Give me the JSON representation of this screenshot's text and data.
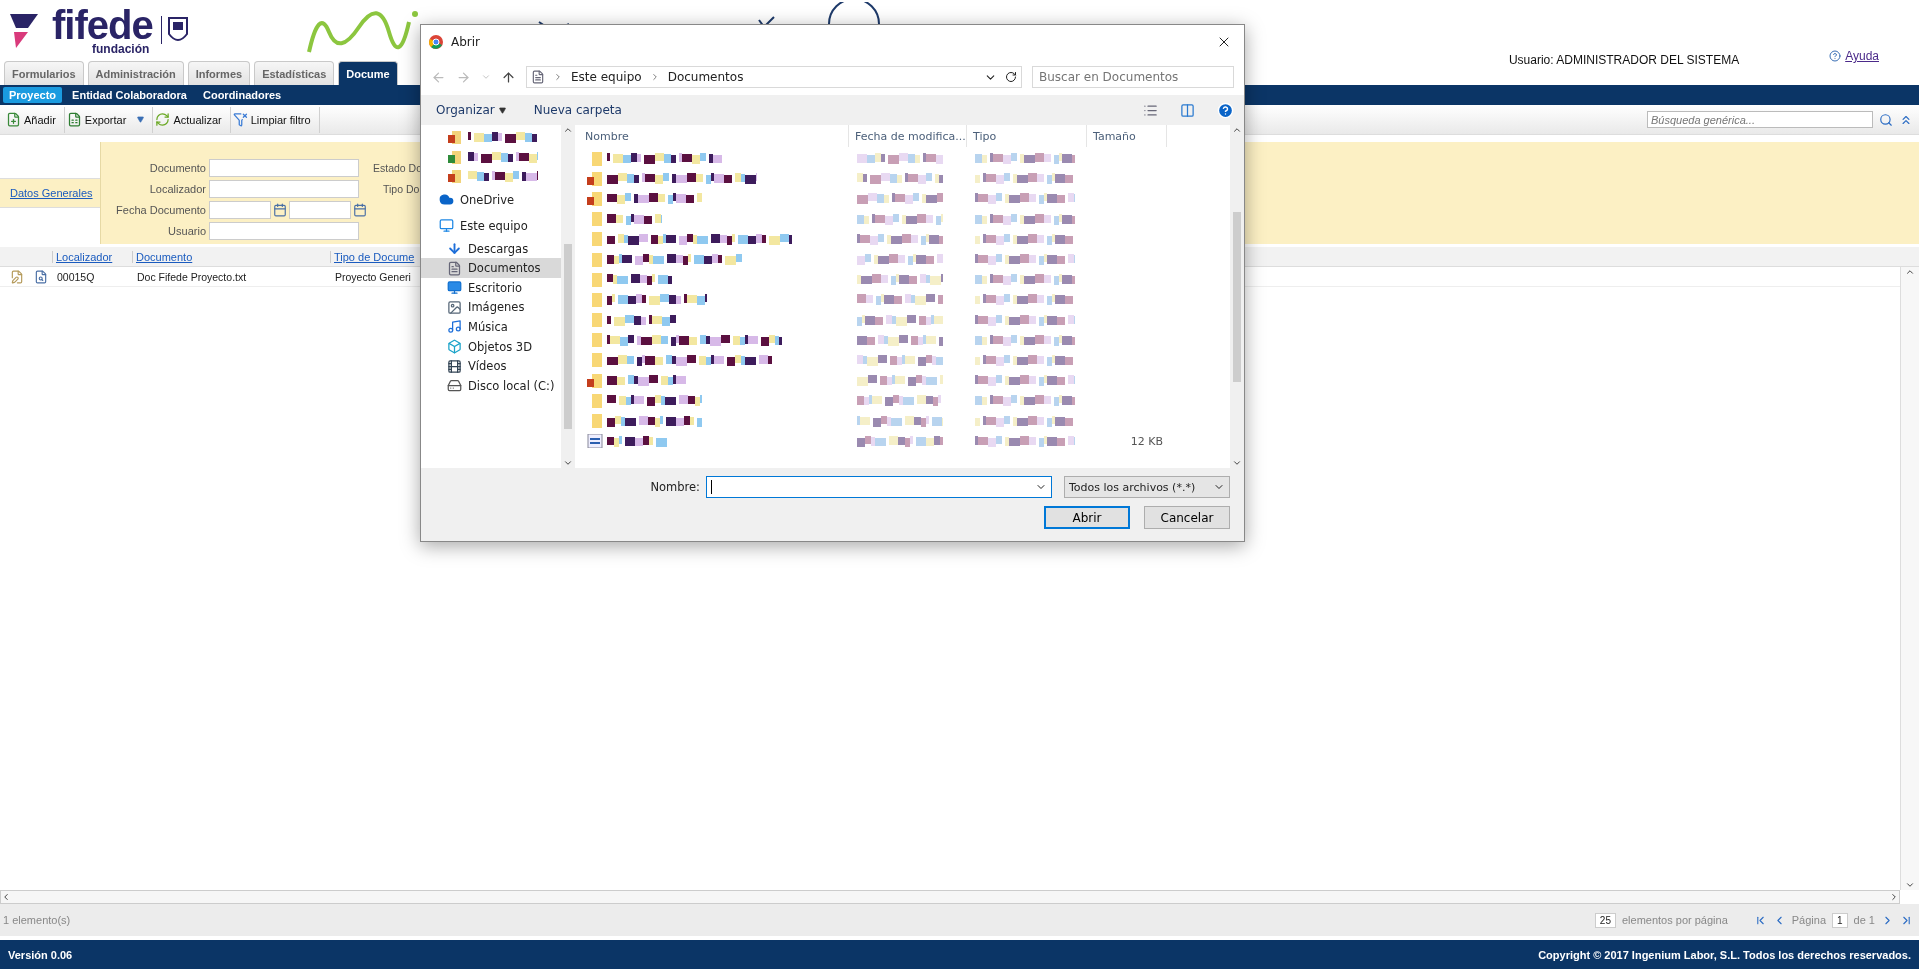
{
  "header": {
    "brand": "fifede",
    "brand_sub": "fundación",
    "user_label": "Usuario: ADMINISTRADOR DEL SISTEMA",
    "help": "Ayuda"
  },
  "main_tabs": [
    {
      "label": "Formularios",
      "selected": false
    },
    {
      "label": "Administración",
      "selected": false
    },
    {
      "label": "Informes",
      "selected": false
    },
    {
      "label": "Estadísticas",
      "selected": false
    },
    {
      "label": "Docume",
      "selected": true
    }
  ],
  "sub_tabs": [
    {
      "label": "Proyecto",
      "selected": true
    },
    {
      "label": "Entidad Colaboradora",
      "selected": false
    },
    {
      "label": "Coordinadores",
      "selected": false
    }
  ],
  "toolbar": [
    {
      "label": "Añadir",
      "kind": "add"
    },
    {
      "label": "Exportar",
      "kind": "export"
    },
    {
      "label": "Actualizar",
      "kind": "refresh"
    },
    {
      "label": "Limpiar filtro",
      "kind": "clear"
    }
  ],
  "search": {
    "placeholder": "Búsqueda genérica..."
  },
  "filter": {
    "section_link": "Datos Generales",
    "fields": [
      {
        "label": "Documento",
        "kind": "text"
      },
      {
        "label": "Localizador",
        "kind": "text"
      },
      {
        "label": "Fecha Documento",
        "kind": "date_range"
      },
      {
        "label": "Usuario",
        "kind": "text"
      }
    ],
    "right_labels": [
      "Estado Do",
      "Tipo Do"
    ]
  },
  "grid": {
    "columns": [
      "Localizador",
      "Documento",
      "Tipo de Docume"
    ],
    "rows": [
      {
        "cells": [
          "00015Q",
          "Doc Fifede Proyecto.txt",
          "Proyecto Generi"
        ]
      }
    ]
  },
  "status": {
    "count": "1 elemento(s)",
    "page_size": "25",
    "page_size_label": "elementos por página",
    "page_label": "Página",
    "page": "1",
    "page_total": "de 1"
  },
  "footer": {
    "version": "Versión 0.06",
    "copyright": "Copyright © 2017 Ingenium Labor, S.L. Todos los derechos reservados."
  },
  "dialog": {
    "title": "Abrir",
    "breadcrumb": [
      "Este equipo",
      "Documentos"
    ],
    "search_placeholder": "Buscar en Documentos",
    "commands": [
      "Organizar",
      "Nueva carpeta"
    ],
    "nav": [
      {
        "kind": "blurred",
        "selected": false
      },
      {
        "kind": "blurred",
        "selected": false
      },
      {
        "kind": "blurred",
        "selected": false
      },
      {
        "kind": "root",
        "label": "OneDrive",
        "selected": false
      },
      {
        "kind": "root",
        "label": "Este equipo",
        "selected": false
      },
      {
        "kind": "place",
        "label": "Descargas",
        "selected": false
      },
      {
        "kind": "place",
        "label": "Documentos",
        "selected": true
      },
      {
        "kind": "place",
        "label": "Escritorio",
        "selected": false
      },
      {
        "kind": "place",
        "label": "Imágenes",
        "selected": false
      },
      {
        "kind": "place",
        "label": "Música",
        "selected": false
      },
      {
        "kind": "place",
        "label": "Objetos 3D",
        "selected": false
      },
      {
        "kind": "place",
        "label": "Vídeos",
        "selected": false
      },
      {
        "kind": "place",
        "label": "Disco local (C:)",
        "selected": false
      }
    ],
    "columns": [
      "Nombre",
      "Fecha de modifica...",
      "Tipo",
      "Tamaño"
    ],
    "files": [
      {
        "kind": "folder"
      },
      {
        "kind": "office"
      },
      {
        "kind": "office"
      },
      {
        "kind": "folder"
      },
      {
        "kind": "folder"
      },
      {
        "kind": "folder"
      },
      {
        "kind": "folder"
      },
      {
        "kind": "folder"
      },
      {
        "kind": "folder"
      },
      {
        "kind": "folder"
      },
      {
        "kind": "folder"
      },
      {
        "kind": "office"
      },
      {
        "kind": "folder"
      },
      {
        "kind": "folder"
      },
      {
        "kind": "document",
        "size": "12 KB"
      }
    ],
    "filename_label": "Nombre:",
    "file_type": "Todos los archivos (*.*)",
    "buttons": [
      {
        "label": "Abrir",
        "default": true
      },
      {
        "label": "Cancelar",
        "default": false
      }
    ]
  }
}
